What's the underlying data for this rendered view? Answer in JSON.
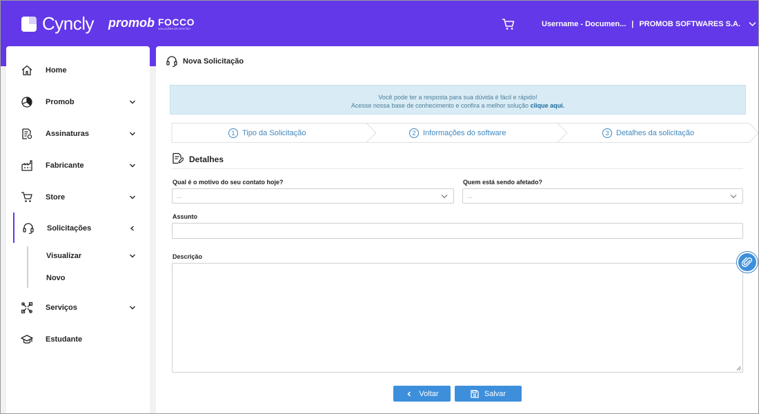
{
  "header": {
    "logo_text": "Cyncly",
    "brand_promob": "promob",
    "brand_focco": "FOCCO",
    "brand_focco_tagline": "SOLUÇÕES DE GESTÃO",
    "username": "Username - Documen...",
    "separator": "|",
    "company": "PROMOB SOFTWARES S.A."
  },
  "sidebar": {
    "items": [
      {
        "label": "Home",
        "icon": "home-icon"
      },
      {
        "label": "Promob",
        "icon": "promob-icon"
      },
      {
        "label": "Assinaturas",
        "icon": "subscriptions-icon"
      },
      {
        "label": "Fabricante",
        "icon": "factory-icon"
      },
      {
        "label": "Store",
        "icon": "cart-icon"
      },
      {
        "label": "Solicitações",
        "icon": "headset-icon"
      },
      {
        "label": "Serviços",
        "icon": "services-icon"
      },
      {
        "label": "Estudante",
        "icon": "graduation-cap-icon"
      }
    ],
    "sub_items": [
      {
        "label": "Visualizar"
      },
      {
        "label": "Novo"
      }
    ]
  },
  "main": {
    "title": "Nova Solicitação",
    "info_line1": "Você pode ter a resposta para sua dúvida é fácil e rápido!",
    "info_line2": "Acesse nossa base de conhecimento e confira a melhor solução",
    "info_link": "clique aqui.",
    "steps": [
      {
        "num": "1",
        "label": "Tipo da Solicitação"
      },
      {
        "num": "2",
        "label": "Informações do software"
      },
      {
        "num": "3",
        "label": "Detalhes da solicitação"
      }
    ],
    "section_title": "Detalhes",
    "fields": {
      "motivo_label": "Qual é o motivo do seu contato hoje?",
      "motivo_value": "...",
      "afetado_label": "Quem está sendo afetado?",
      "afetado_value": "...",
      "assunto_label": "Assunto",
      "assunto_value": "",
      "descricao_label": "Descrição",
      "descricao_value": ""
    },
    "buttons": {
      "back": "Voltar",
      "save": "Salvar"
    }
  },
  "colors": {
    "header_bg": "#6338e8",
    "accent_blue": "#3d8fdc",
    "info_bg": "#d9ecf5"
  }
}
